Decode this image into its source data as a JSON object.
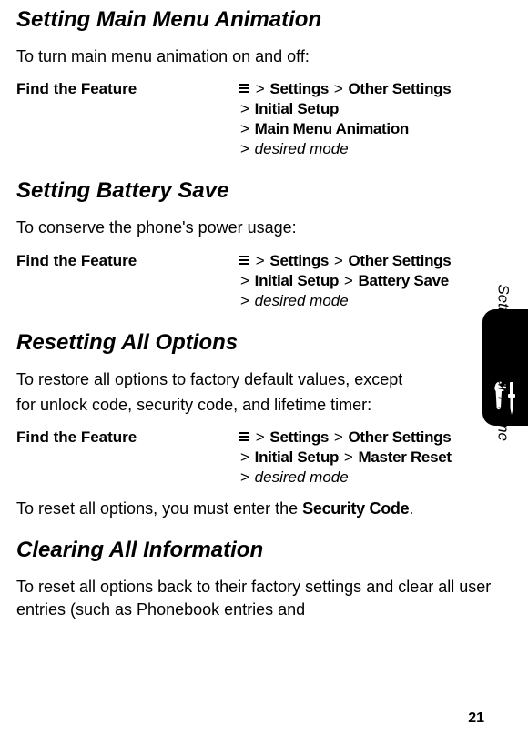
{
  "headings": {
    "main_menu_animation": "Setting Main Menu Animation",
    "battery_save": "Setting Battery Save",
    "resetting_options": "Resetting All Options",
    "clearing_info": "Clearing All Information"
  },
  "intros": {
    "main_menu_animation": "To turn main menu animation on and off:",
    "battery_save": "To conserve the phone's power usage:",
    "resetting_options_1": "To restore all options to factory default values, except",
    "resetting_options_2": "for unlock code, security code, and lifetime timer:",
    "security_before": "To reset all options, you must enter the ",
    "security_code": "Security Code",
    "security_after": ".",
    "clearing_info": "To reset all options back to their factory settings and clear all user entries (such as Phonebook entries and"
  },
  "feature_label": "Find the Feature",
  "paths": {
    "sep": ">",
    "settings": "Settings",
    "other_settings": "Other Settings",
    "initial_setup": "Initial Setup",
    "main_menu_animation": "Main Menu Animation",
    "battery_save": "Battery Save",
    "master_reset": "Master Reset",
    "desired_mode": "desired mode"
  },
  "side_label": "Setting Up Your Phone",
  "page_number": "21"
}
